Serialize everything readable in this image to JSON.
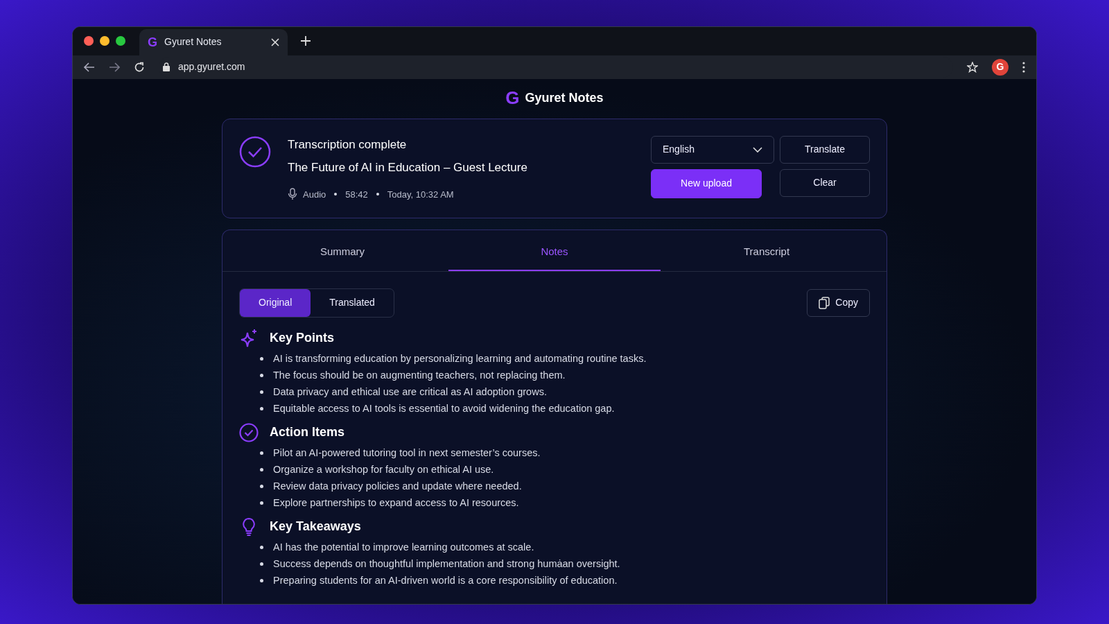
{
  "browser": {
    "tab": {
      "title": "Gyuret Notes",
      "logo": "G"
    },
    "address": "app.gyuret.com",
    "avatar": "G"
  },
  "app": {
    "logo": "G",
    "title": "Gyuret Notes"
  },
  "status": {
    "title": "Transcription complete",
    "name": "The Future of AI in Education – Guest Lecture",
    "meta": [
      "Audio",
      "58:42",
      "Today, 10:32 AM"
    ]
  },
  "language": {
    "value": "English"
  },
  "buttons": [
    {
      "label": "Translate",
      "kind": "outline"
    },
    {
      "label": "New upload",
      "kind": "primary"
    },
    {
      "label": "Clear",
      "kind": "outline"
    }
  ],
  "tabs": [
    {
      "label": "Summary",
      "selected": false
    },
    {
      "label": "Notes",
      "selected": true
    },
    {
      "label": "Transcript",
      "selected": false
    }
  ],
  "view_toggle": [
    {
      "label": "Original",
      "selected": true
    },
    {
      "label": "Translated",
      "selected": false
    }
  ],
  "copy_button": "Copy",
  "sections": [
    {
      "kind": "sparkle",
      "title": "Key Points",
      "items": [
        "AI is transforming education by personalizing learning and automating routine tasks.",
        "The focus should be on augmenting teachers, not replacing them.",
        "Data privacy and ethical use are critical as AI adoption grows.",
        "Equitable access to AI tools is essential to avoid widening the education gap."
      ]
    },
    {
      "kind": "check",
      "title": "Action Items",
      "items": [
        "Pilot an AI-powered tutoring tool in next semester’s courses.",
        "Organize a workshop for faculty on ethical AI use.",
        "Review data privacy policies and update where needed.",
        "Explore partnerships to expand access to AI resources."
      ]
    },
    {
      "kind": "bulb",
      "title": "Key Takeaways",
      "items": [
        "AI has the potential to improve learning outcomes at scale.",
        "Success depends on thoughtful implementation and strong humȧan oversight.",
        "Preparing students for an AI-driven world is a core responsibility of education."
      ]
    }
  ]
}
